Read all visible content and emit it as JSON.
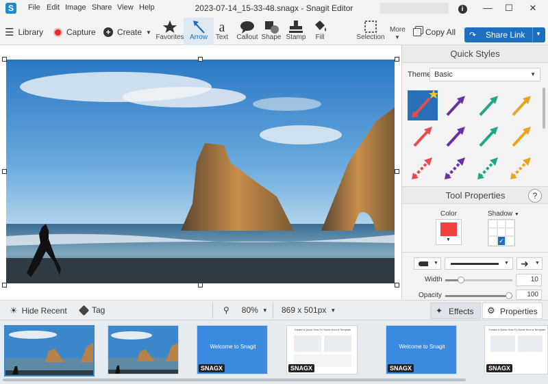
{
  "titlebar": {
    "menu": [
      "File",
      "Edit",
      "Image",
      "Share",
      "View",
      "Help"
    ],
    "title": "2023-07-14_15-33-48.snagx - Snagit Editor"
  },
  "toolbar": {
    "library_label": "Library",
    "capture_label": "Capture",
    "create_label": "Create",
    "tools": [
      "Favorites",
      "Arrow",
      "Text",
      "Callout",
      "Shape",
      "Stamp",
      "Fill"
    ],
    "selection_label": "Selection",
    "more_label": "More",
    "copy_all_label": "Copy All",
    "share_link_label": "Share Link"
  },
  "quick_styles": {
    "header": "Quick Styles",
    "theme_label": "Theme:",
    "theme_value": "Basic",
    "arrow_colors": [
      "#e74c4c",
      "#6a2fa3",
      "#1fa58a",
      "#e8a41c"
    ]
  },
  "tool_properties": {
    "header": "Tool Properties",
    "help": "?",
    "color_label": "Color",
    "shadow_label": "Shadow",
    "color_value": "#f04040",
    "width_label": "Width",
    "width_value": "10",
    "opacity_label": "Opacity",
    "opacity_value": "100"
  },
  "bottombar": {
    "hide_recent": "Hide Recent",
    "tag": "Tag",
    "zoom": "80%",
    "dimensions": "869 x 501px",
    "effects": "Effects",
    "properties": "Properties"
  },
  "tray": {
    "badge": "SNAGX",
    "welcome_text": "Welcome to Snagit",
    "doc_title": "Create a Quick How-To Guide from a Template"
  }
}
